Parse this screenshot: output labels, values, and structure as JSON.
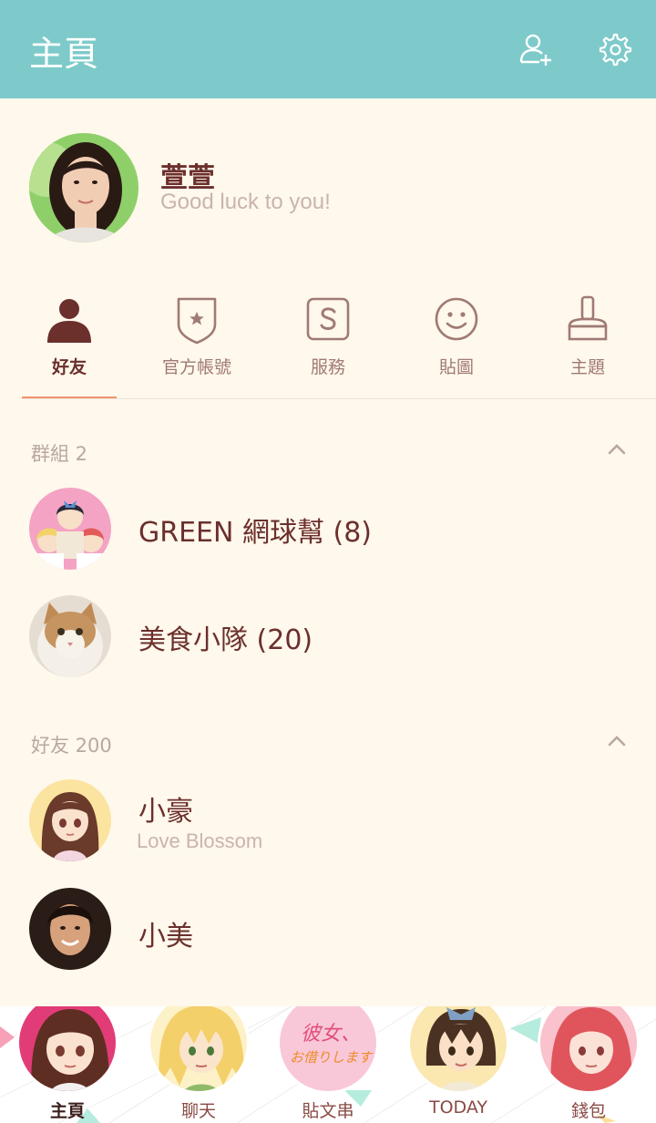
{
  "header": {
    "title": "主頁",
    "add_friend_icon": "add-friend-icon",
    "settings_icon": "gear-icon"
  },
  "profile": {
    "name": "萱萱",
    "status": "Good luck to you!"
  },
  "tabs": [
    {
      "label": "好友",
      "icon": "person-icon",
      "active": true
    },
    {
      "label": "官方帳號",
      "icon": "shield-star-icon",
      "active": false
    },
    {
      "label": "服務",
      "icon": "s-box-icon",
      "active": false
    },
    {
      "label": "貼圖",
      "icon": "smiley-icon",
      "active": false
    },
    {
      "label": "主題",
      "icon": "brush-icon",
      "active": false
    }
  ],
  "groups": {
    "header": "群組 2",
    "items": [
      {
        "name": "GREEN 網球幫 (8)"
      },
      {
        "name": "美食小隊 (20)"
      }
    ]
  },
  "friends": {
    "header": "好友 200",
    "items": [
      {
        "name": "小豪",
        "status": "Love Blossom"
      },
      {
        "name": "小美",
        "status": ""
      }
    ]
  },
  "bottom_nav": [
    {
      "label": "主頁",
      "active": true
    },
    {
      "label": "聊天",
      "active": false
    },
    {
      "label": "貼文串",
      "active": false,
      "logo_text": "彼女、お借りします"
    },
    {
      "label": "TODAY",
      "active": false
    },
    {
      "label": "錢包",
      "active": false
    }
  ],
  "colors": {
    "header_bg": "#7ecaca",
    "page_bg": "#fff8ec",
    "text_primary": "#6b2f2c",
    "text_muted": "#c9b4ae",
    "tab_underline": "#f0926c"
  }
}
